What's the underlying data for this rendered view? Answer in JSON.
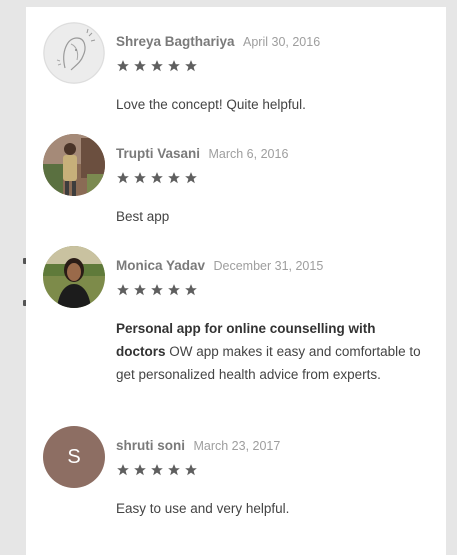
{
  "reviews": [
    {
      "name": "Shreya Bagthariya",
      "date": "April 30, 2016",
      "rating": 5,
      "title": "",
      "text": "Love the concept! Quite helpful.",
      "avatar": "sketch-illustration-avatar"
    },
    {
      "name": "Trupti Vasani",
      "date": "March 6, 2016",
      "rating": 5,
      "title": "",
      "text": "Best app",
      "avatar": "photo-avatar"
    },
    {
      "name": "Monica Yadav",
      "date": "December 31, 2015",
      "rating": 5,
      "title": "Personal app for online counselling with doctors",
      "text": "OW app makes it easy and comfortable to get personalized health advice from experts.",
      "avatar": "photo-avatar"
    },
    {
      "name": "shruti soni",
      "date": "March 23, 2017",
      "rating": 5,
      "title": "",
      "text": "Easy to use and very helpful.",
      "avatar": "letter-avatar",
      "avatar_letter": "S"
    }
  ],
  "colors": {
    "star": "#5f5f5f",
    "letter_avatar_bg": "#8d6e63",
    "page_bg": "#e6e6e6",
    "card_bg": "#ffffff"
  }
}
